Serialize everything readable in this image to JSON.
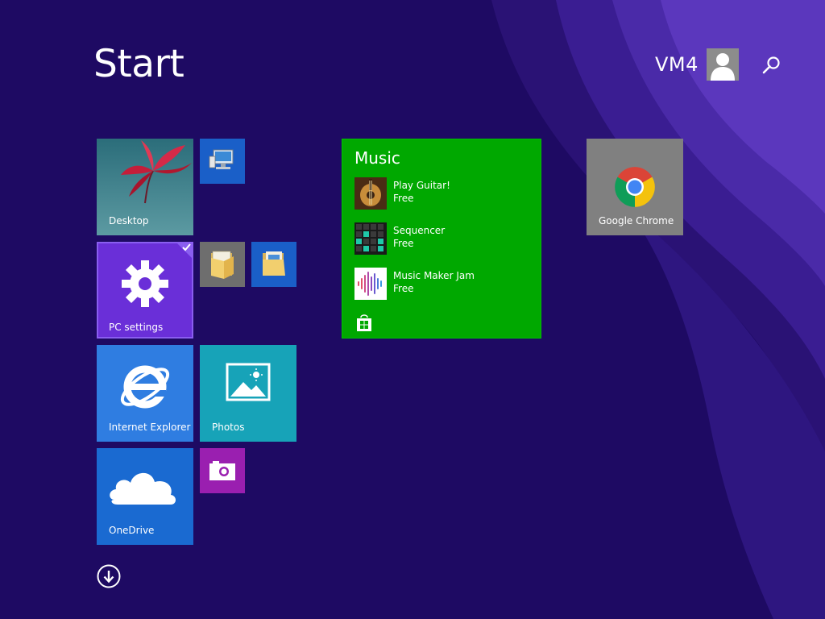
{
  "start": {
    "title": "Start",
    "user_name": "VM4"
  },
  "tiles": {
    "desktop": "Desktop",
    "pc_settings": "PC settings",
    "internet_explorer": "Internet Explorer",
    "photos": "Photos",
    "onedrive": "OneDrive",
    "google_chrome": "Google Chrome"
  },
  "music": {
    "title": "Music",
    "items": [
      {
        "name": "Play Guitar!",
        "price": "Free",
        "icon": "guitar-icon"
      },
      {
        "name": "Sequencer",
        "price": "Free",
        "icon": "sequencer-grid-icon"
      },
      {
        "name": "Music Maker Jam",
        "price": "Free",
        "icon": "waveform-icon"
      }
    ],
    "store_icon": "store-bag-icon"
  },
  "colors": {
    "background": "#1e0a63",
    "music_tile": "#00a800",
    "settings_tile": "#6a2fd8",
    "ie_tile": "#2f7de1",
    "photos_tile": "#17a3b8",
    "onedrive_tile": "#1a6ad1",
    "camera_tile": "#9a1fb0",
    "chrome_tile": "#808080"
  },
  "icons": [
    "search-icon",
    "user-avatar-icon",
    "gear-icon",
    "ie-logo-icon",
    "photo-landscape-icon",
    "cloud-icon",
    "camera-icon",
    "chrome-logo-icon",
    "computer-icon",
    "folder-icon",
    "down-arrow-circle-icon",
    "checkmark-icon"
  ]
}
